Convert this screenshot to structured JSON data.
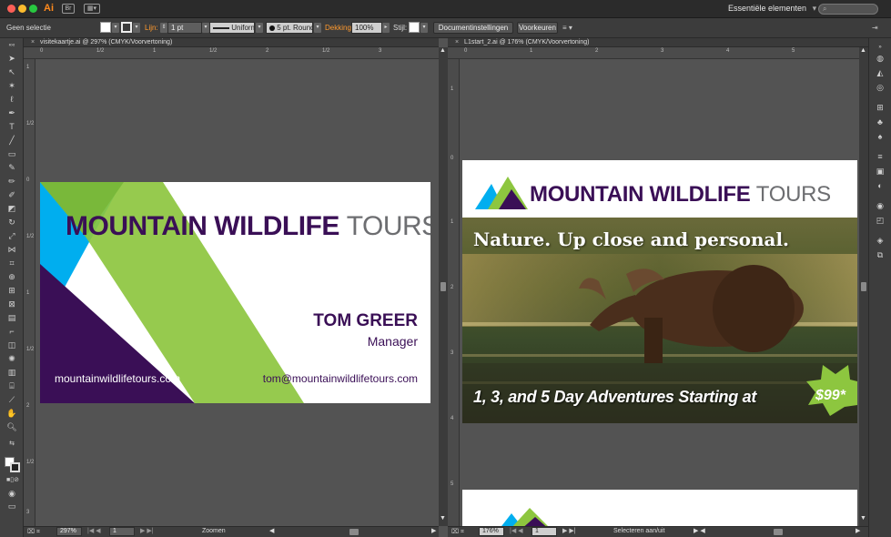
{
  "app": {
    "logo": "Ai",
    "workspace": "Essentiële elementen",
    "workspace_arrow": "▾",
    "search_placeholder": ""
  },
  "controlbar": {
    "selection": "Geen selectie",
    "stroke_label": "Lijn:",
    "stroke_weight": "1 pt",
    "profile": "Uniform",
    "brush": "5 pt. Round",
    "opacity_label": "Dekking:",
    "opacity_value": "100%",
    "style_label": "Stijl:",
    "doc_settings": "Documentinstellingen",
    "preferences": "Voorkeuren"
  },
  "left_doc": {
    "tab_close": "×",
    "tab_title": "visitekaartje.ai @ 297% (CMYK/Voorvertoning)",
    "hruler": [
      "0",
      "1/2",
      "1",
      "1/2",
      "2",
      "1/2",
      "3"
    ],
    "vruler": [
      "1",
      "1/2",
      "0",
      "1/2",
      "1",
      "1/2",
      "2",
      "1/2",
      "3"
    ],
    "zoom": "297%",
    "page": "1",
    "status_label": "Zoomen"
  },
  "right_doc": {
    "tab_close": "×",
    "tab_title": "L1start_2.ai @ 176% (CMYK/Voorvertoning)",
    "hruler": [
      "0",
      "1",
      "2",
      "3",
      "4",
      "5"
    ],
    "vruler": [
      "1",
      "0",
      "1",
      "2",
      "3",
      "4",
      "5"
    ],
    "zoom": "176%",
    "page": "1",
    "status_label": "Selecteren aan/uit"
  },
  "card": {
    "title_bold": "MOUNTAIN WILDLIFE",
    "title_thin": "TOURS",
    "name": "TOM GREER",
    "role": "Manager",
    "website": "mountainwildlifetours.com",
    "email": "tom@mountainwildlifetours.com"
  },
  "ad": {
    "title_bold": "MOUNTAIN WILDLIFE",
    "title_thin": "TOURS",
    "headline": "Nature. Up close and personal.",
    "tagline": "1, 3, and 5 Day Adventures Starting at",
    "price": "$99*"
  },
  "colors": {
    "purple": "#3a0f56",
    "green": "#8dc63f",
    "cyan": "#00aeef",
    "orange_label": "#ff9a2e"
  }
}
